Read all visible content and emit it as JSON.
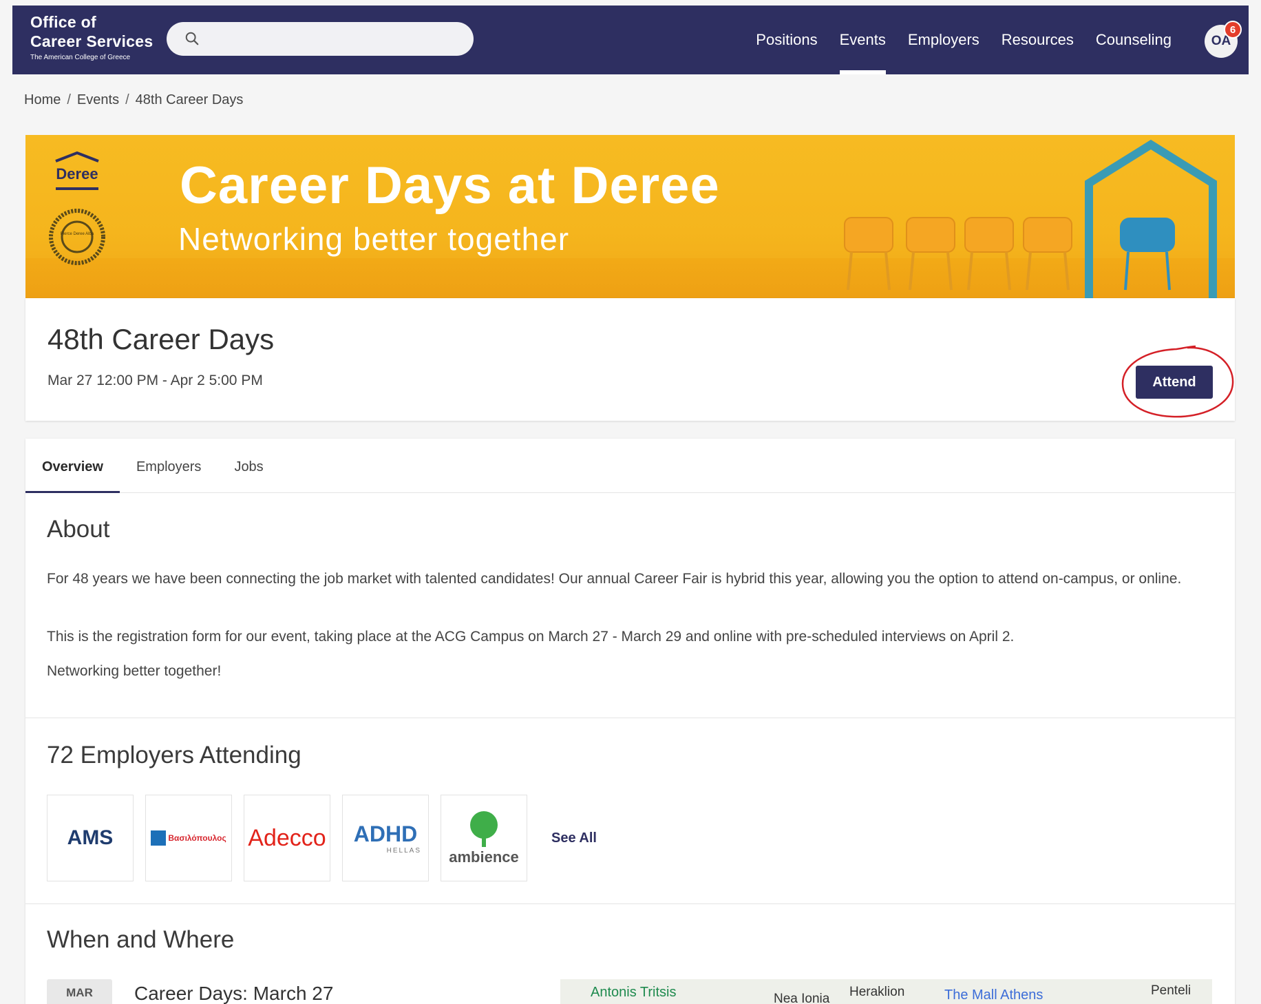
{
  "navbar": {
    "brand_line1": "Office of",
    "brand_line2": "Career Services",
    "brand_line3": "The American College of Greece",
    "search_placeholder": "",
    "links": [
      "Positions",
      "Events",
      "Employers",
      "Resources",
      "Counseling"
    ],
    "active_link": "Events",
    "avatar_initials": "OA",
    "notification_count": "6",
    "colors": {
      "bar": "#2e2f61",
      "badge": "#e33d2b"
    }
  },
  "breadcrumb": {
    "home": "Home",
    "events": "Events",
    "current": "48th Career Days",
    "separator": "/"
  },
  "banner": {
    "title": "Career Days at Deree",
    "subtitle": "Networking better together",
    "logo_text": "Deree",
    "seal_text": "Pierce Deree Alba",
    "color": "#f7bb22"
  },
  "event": {
    "title": "48th Career Days",
    "dates": "Mar 27 12:00 PM - Apr 2 5:00 PM",
    "attend_label": "Attend"
  },
  "tabs": [
    "Overview",
    "Employers",
    "Jobs"
  ],
  "active_tab": "Overview",
  "about": {
    "heading": "About",
    "p1": "For 48 years we have been connecting the job market with talented candidates! Our annual Career Fair is hybrid this year, allowing you the option to attend on-campus, or online.",
    "p2": "This is the registration form for our event, taking place at the ACG Campus on March 27 - March 29 and online with pre-scheduled interviews on April 2.",
    "p3": "Networking better together!"
  },
  "employers": {
    "heading": "72 Employers Attending",
    "logos": [
      "AMS",
      "Βασιλόπουλος",
      "Adecco",
      "ADHD",
      "ambience"
    ],
    "adhd_sub": "HELLAS",
    "see_all": "See All"
  },
  "when_where": {
    "heading": "When and Where",
    "month": "MAR",
    "event_name": "Career Days: March 27",
    "map_labels": [
      "Antonis Tritsis",
      "Nea Ionia",
      "Heraklion",
      "The Mall Athens",
      "Penteli"
    ]
  }
}
